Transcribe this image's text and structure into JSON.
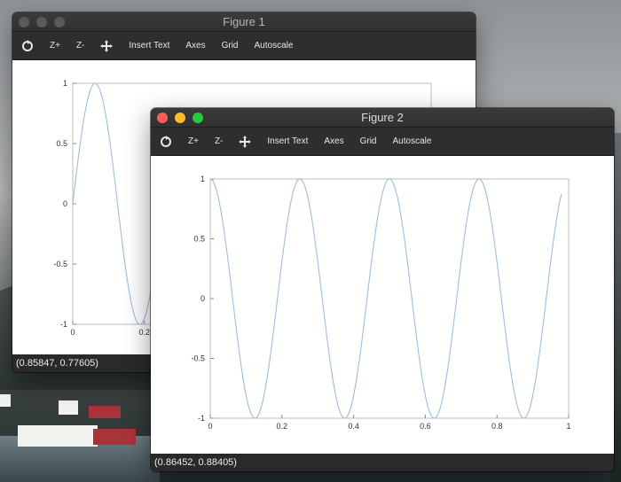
{
  "windows": [
    {
      "title": "Figure 1",
      "toolbar": {
        "refresh_icon": "refresh-icon",
        "zoom_in": "Z+",
        "zoom_out": "Z-",
        "pan_icon": "move-arrows-icon",
        "insert_text": "Insert Text",
        "axes": "Axes",
        "grid": "Grid",
        "autoscale": "Autoscale"
      },
      "status": "(0.85847, 0.77605)",
      "state": "inactive"
    },
    {
      "title": "Figure 2",
      "toolbar": {
        "refresh_icon": "refresh-icon",
        "zoom_in": "Z+",
        "zoom_out": "Z-",
        "pan_icon": "move-arrows-icon",
        "insert_text": "Insert Text",
        "axes": "Axes",
        "grid": "Grid",
        "autoscale": "Autoscale"
      },
      "status": "(0.86452, 0.88405)",
      "state": "active"
    }
  ],
  "colors": {
    "line": "#9bbde0",
    "traffic_close": "#fc5f57",
    "traffic_min": "#fdbc2e",
    "traffic_max": "#28c840"
  },
  "chart_data": [
    {
      "type": "line",
      "function": "sin(2*pi*4*x)",
      "x_range": [
        0,
        0.26
      ],
      "xlim": [
        0,
        1
      ],
      "ylim": [
        -1,
        1
      ],
      "xticks": [
        "0",
        "0.2"
      ],
      "yticks": [
        "1",
        "0.5",
        "0",
        "-0.5",
        "-1"
      ],
      "grid": false
    },
    {
      "type": "line",
      "function": "cos(2*pi*4*x)",
      "x_range": [
        0,
        0.98
      ],
      "xlim": [
        0,
        1
      ],
      "ylim": [
        -1,
        1
      ],
      "xticks": [
        "0",
        "0.2",
        "0.4",
        "0.6",
        "0.8",
        "1"
      ],
      "yticks": [
        "1",
        "0.5",
        "0",
        "-0.5",
        "-1"
      ],
      "grid": false
    }
  ]
}
